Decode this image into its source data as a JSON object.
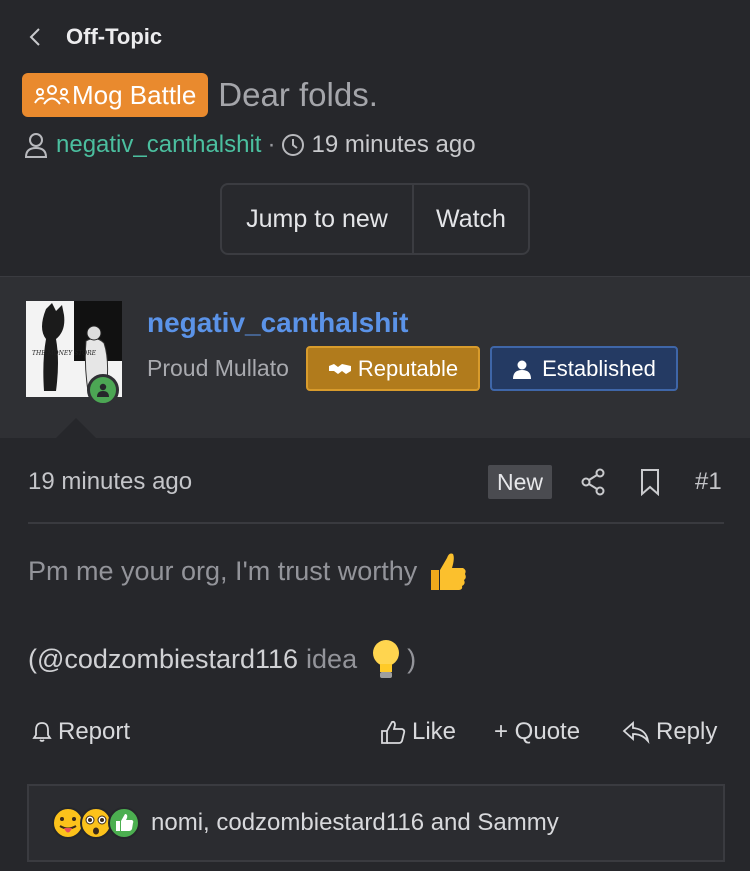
{
  "nav": {
    "back_label": "Off-Topic"
  },
  "thread": {
    "prefix": "Mog Battle",
    "title": "Dear folds.",
    "author": "negativ_canthalshit",
    "separator": "·",
    "time": "19 minutes ago"
  },
  "thread_buttons": {
    "jump": "Jump to new",
    "watch": "Watch"
  },
  "user": {
    "name": "negativ_canthalshit",
    "title": "Proud Mullato",
    "badges": [
      {
        "label": "Reputable",
        "color": "#b17b1c"
      },
      {
        "label": "Established",
        "color": "#243a63"
      }
    ],
    "avatar_text": "THE MONEY STORE"
  },
  "post": {
    "time": "19 minutes ago",
    "new_label": "New",
    "number": "#1",
    "line1": "Pm me your org, I'm trust worthy",
    "mention": "(@codzombiestard116",
    "mention_tail": "idea",
    "close_paren": ")"
  },
  "actions": {
    "report": "Report",
    "like": "Like",
    "quote": "+ Quote",
    "reply": "Reply"
  },
  "reactions": {
    "text": "nomi, codzombiestard116 and Sammy"
  },
  "colors": {
    "accent": "#5b93e8",
    "link": "#4bbf9f",
    "prefix": "#e98a2e"
  }
}
